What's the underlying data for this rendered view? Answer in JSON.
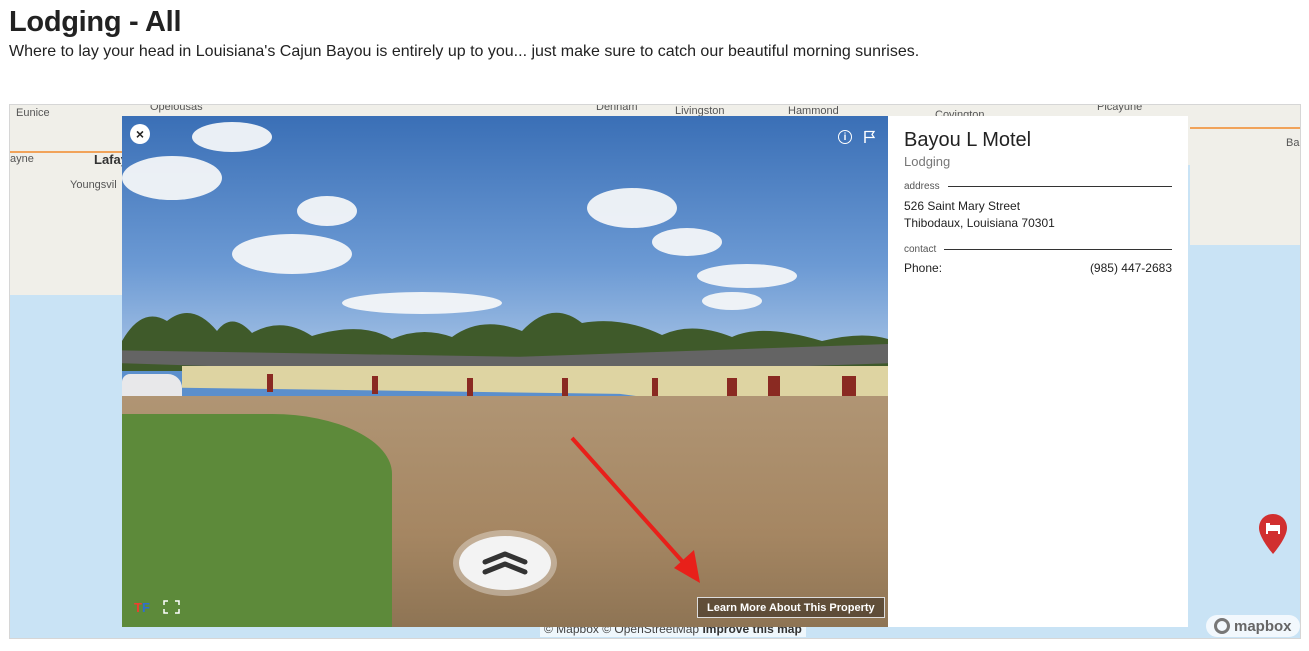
{
  "header": {
    "title": "Lodging - All",
    "subtitle": "Where to lay your head in Louisiana's Cajun Bayou is entirely up to you... just make sure to catch our beautiful morning sunrises."
  },
  "map": {
    "labels": {
      "eunice": "Eunice",
      "opelousas": "Opelousas",
      "denham": "Denham",
      "livingston": "Livingston",
      "hammond": "Hammond",
      "covington": "Covington",
      "picayune": "Picayune",
      "wayne": "ayne",
      "lafayette": "Lafay",
      "youngsville": "Youngsvil",
      "ba": "Ba"
    },
    "attribution": {
      "mapbox": "© Mapbox",
      "osm": "© OpenStreetMap",
      "improve": "Improve this map"
    },
    "logo_text": "mapbox",
    "pin_icon": "lodging-bed-icon",
    "pin_color": "#d12f2f"
  },
  "viewer": {
    "close_label": "×",
    "learn_more": "Learn More About This Property",
    "logo_text_a": "T",
    "logo_text_b": "F"
  },
  "listing": {
    "name": "Bayou L Motel",
    "category": "Lodging",
    "address_label": "address",
    "street": "526 Saint Mary Street",
    "city_state_zip": "Thibodaux, Louisiana 70301",
    "contact_label": "contact",
    "phone_label": "Phone:",
    "phone_value": "(985) 447-2683"
  },
  "colors": {
    "water": "#c9e3f5",
    "land": "#f0efe9",
    "road": "#f1a35a",
    "arrow": "#e8201a"
  }
}
